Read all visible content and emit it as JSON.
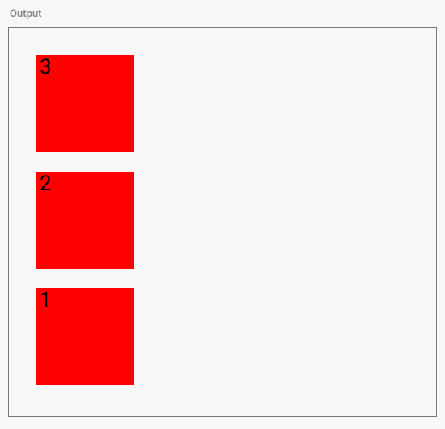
{
  "panel": {
    "title": "Output"
  },
  "boxes": [
    {
      "label": "1"
    },
    {
      "label": "2"
    },
    {
      "label": "3"
    }
  ],
  "colors": {
    "box_bg": "#ff0000",
    "page_bg": "#f7f7f7",
    "border": "#777777",
    "title": "#888888"
  }
}
